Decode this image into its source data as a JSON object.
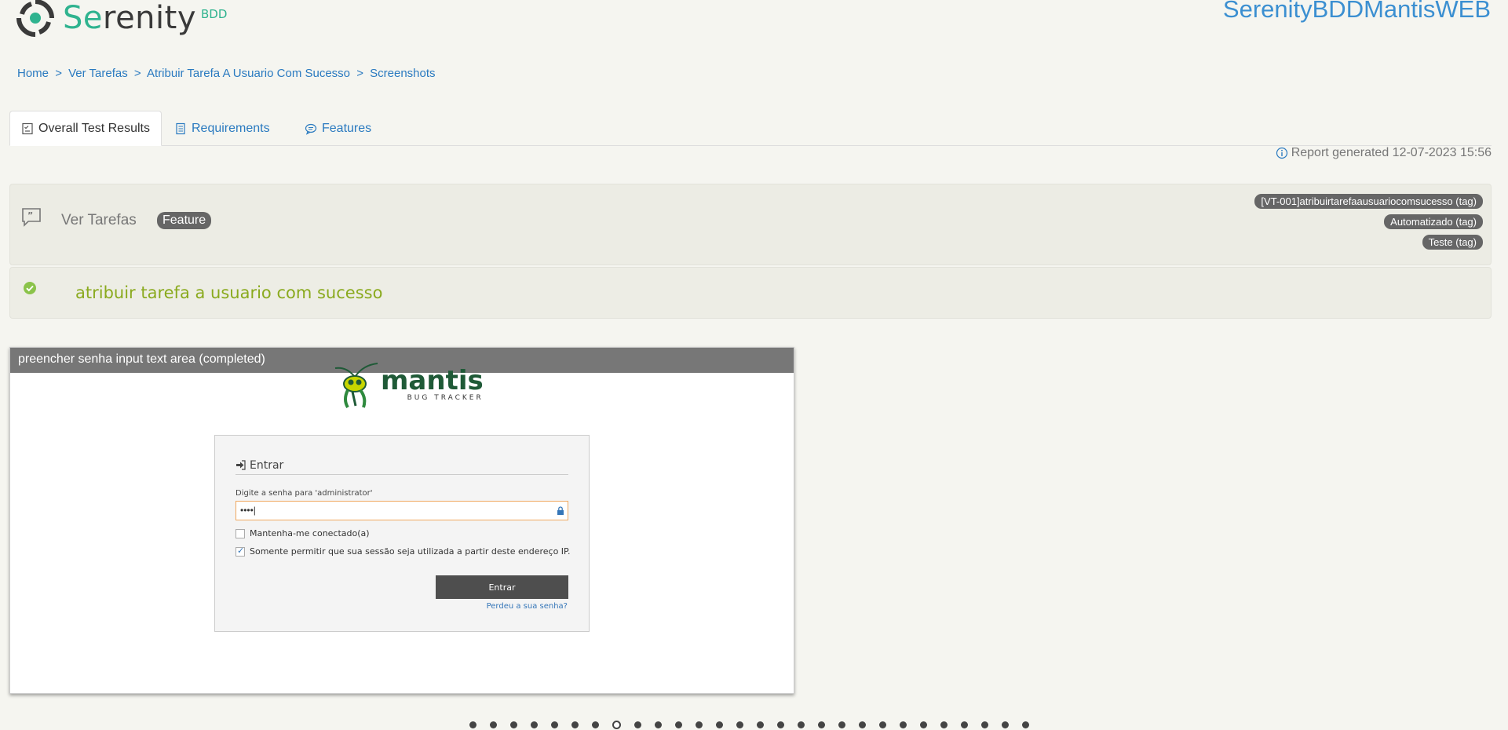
{
  "header": {
    "logo_text_accent": "Se",
    "logo_text_rest": "renity",
    "logo_bdd": "BDD",
    "project_title": "SerenityBDDMantisWEB"
  },
  "breadcrumb": {
    "items": [
      "Home",
      "Ver Tarefas",
      "Atribuir Tarefa A Usuario Com Sucesso",
      "Screenshots"
    ],
    "separator": ">"
  },
  "tabs": [
    {
      "label": "Overall Test Results",
      "icon": "checklist-icon",
      "active": true
    },
    {
      "label": "Requirements",
      "icon": "book-icon",
      "active": false
    },
    {
      "label": "Features",
      "icon": "comment-icon",
      "active": false
    }
  ],
  "report_generated": "Report generated 12-07-2023 15:56",
  "feature": {
    "name": "Ver Tarefas",
    "badge": "Feature",
    "tags": [
      "[VT-001]atribuirtarefaausuariocomsucesso (tag)",
      "Automatizado (tag)",
      "Teste (tag)"
    ]
  },
  "scenario": {
    "title": "atribuir tarefa a usuario com sucesso",
    "status_color": "#8bc34a"
  },
  "screenshot": {
    "caption": "preencher senha input text area (completed)",
    "app": {
      "logo_word": "mantis",
      "logo_sub": "BUG TRACKER",
      "login_title": "Entrar",
      "password_label": "Digite a senha para 'administrator'",
      "password_value": "••••|",
      "remember_label": "Mantenha-me conectado(a)",
      "remember_checked": false,
      "ip_label": "Somente permitir que sua sessão seja utilizada a partir deste endereço IP.",
      "ip_checked": true,
      "submit_label": "Entrar",
      "lost_password": "Perdeu a sua senha?"
    }
  },
  "carousel": {
    "count": 28,
    "active_index": 7
  },
  "colors": {
    "accent": "#2fb38f",
    "link": "#2a7ac0",
    "title": "#3b8fd1",
    "scenario": "#8aaa1e"
  }
}
